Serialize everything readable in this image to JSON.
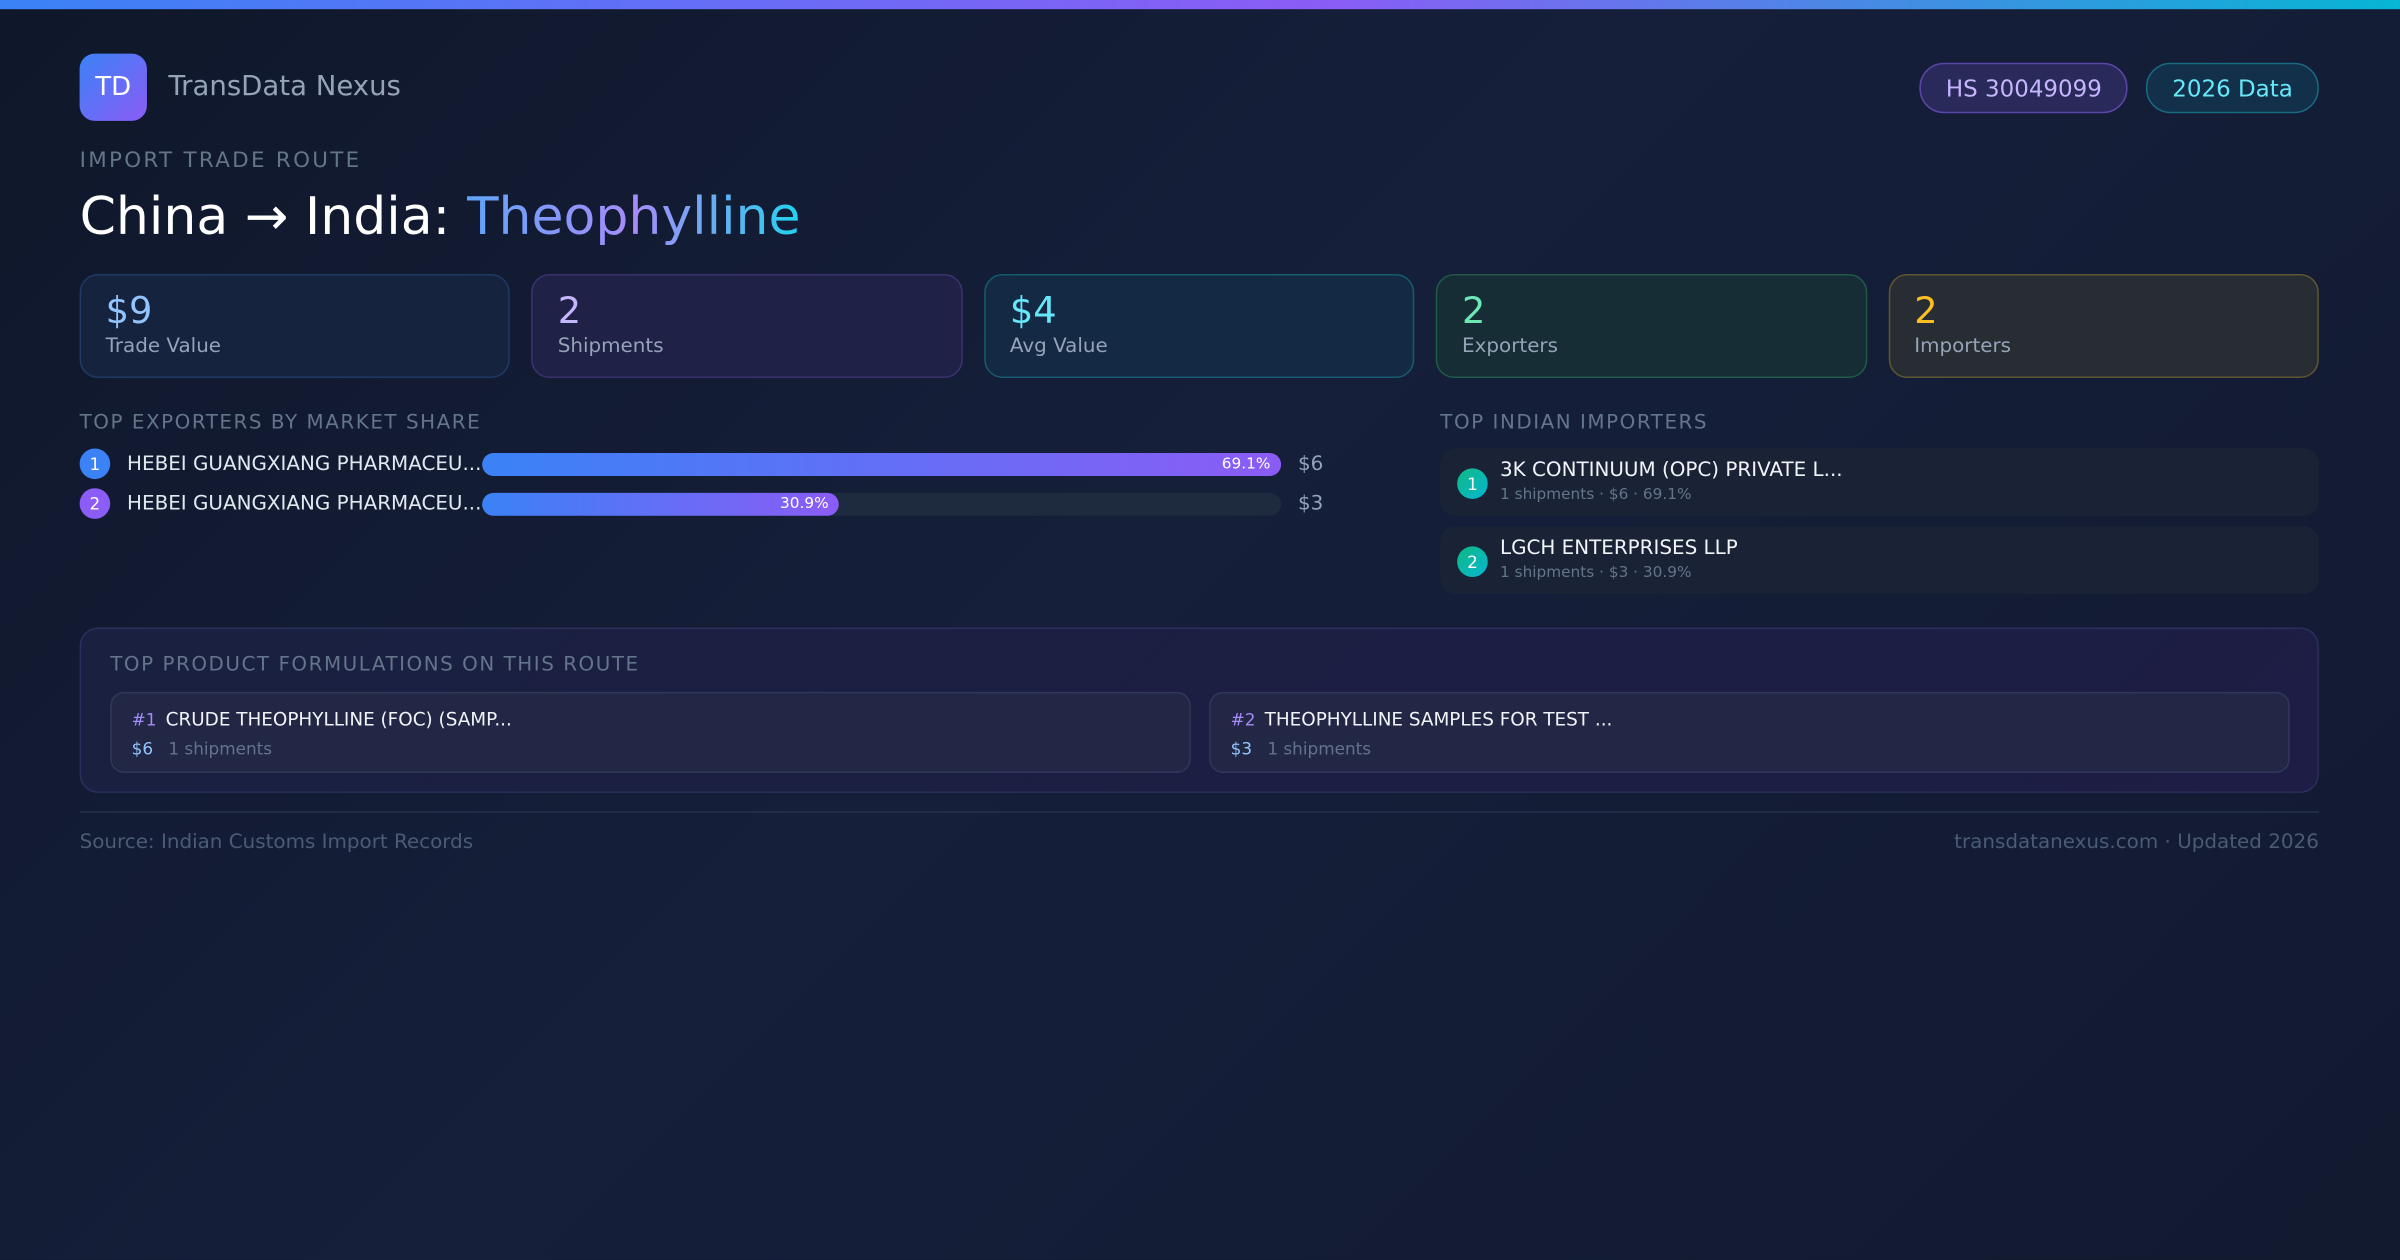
{
  "brand": {
    "logo": "TD",
    "name": "TransData Nexus"
  },
  "badges": {
    "hs": "HS 30049099",
    "year": "2026 Data"
  },
  "eyebrow": "IMPORT TRADE ROUTE",
  "title": {
    "route": "China → India: ",
    "product": "Theophylline"
  },
  "stats": [
    {
      "value": "$9",
      "label": "Trade Value"
    },
    {
      "value": "2",
      "label": "Shipments"
    },
    {
      "value": "$4",
      "label": "Avg Value"
    },
    {
      "value": "2",
      "label": "Exporters"
    },
    {
      "value": "2",
      "label": "Importers"
    }
  ],
  "exporters": {
    "heading": "TOP EXPORTERS BY MARKET SHARE",
    "items": [
      {
        "rank": "1",
        "name": "HEBEI GUANGXIANG PHARMACEU...",
        "share": 69.1,
        "share_label": "69.1%",
        "value": "$6"
      },
      {
        "rank": "2",
        "name": "HEBEI GUANGXIANG PHARMACEU...",
        "share": 30.9,
        "share_label": "30.9%",
        "value": "$3"
      }
    ]
  },
  "importers": {
    "heading": "TOP INDIAN IMPORTERS",
    "items": [
      {
        "rank": "1",
        "name": "3K CONTINUUM (OPC) PRIVATE L...",
        "meta": "1 shipments · $6 · 69.1%"
      },
      {
        "rank": "2",
        "name": "LGCH ENTERPRISES LLP",
        "meta": "1 shipments · $3 · 30.9%"
      }
    ]
  },
  "formulations": {
    "heading": "TOP PRODUCT FORMULATIONS ON THIS ROUTE",
    "items": [
      {
        "rank": "#1",
        "name": "CRUDE THEOPHYLLINE (FOC) (SAMP...",
        "value": "$6",
        "shipments": "1 shipments"
      },
      {
        "rank": "#2",
        "name": "THEOPHYLLINE SAMPLES FOR TEST ...",
        "value": "$3",
        "shipments": "1 shipments"
      }
    ]
  },
  "footer": {
    "source": "Source: Indian Customs Import Records",
    "site": "transdatanexus.com · Updated 2026"
  },
  "colors": {
    "exporter_rank_1": "#3b82f6",
    "exporter_rank_2": "#8b5cf6"
  }
}
